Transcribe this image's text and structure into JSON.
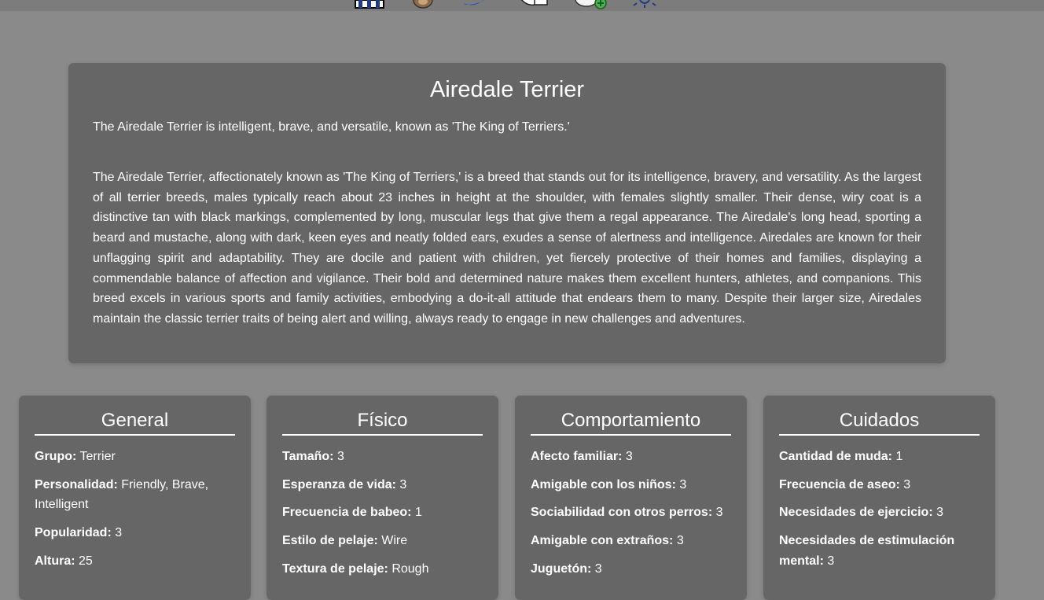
{
  "nav": {
    "icons": [
      "stats-icon",
      "dog-face-icon",
      "swoosh-icon",
      "hand-pet-icon",
      "add-dog-icon",
      "sun-icon"
    ]
  },
  "breed": {
    "name": "Airedale Terrier",
    "short_description": "The Airedale Terrier is intelligent, brave, and versatile, known as 'The King of Terriers.'",
    "long_description": "The Airedale Terrier, affectionately known as 'The King of Terriers,' is a breed that stands out for its intelligence, bravery, and versatility. As the largest of all terrier breeds, males typically reach about 23 inches in height at the shoulder, with females slightly smaller. Their dense, wiry coat is a distinctive tan with black markings, complemented by long, muscular legs that give them a regal appearance. The Airedale's long head, sporting a beard and mustache, along with dark, keen eyes and neatly folded ears, exudes a sense of alertness and intelligence. Airedales are known for their unflagging spirit and adaptability. They are docile and patient with children, yet fiercely protective of their homes and families, displaying a commendable balance of affection and vigilance. Their bold and determined nature makes them excellent hunters, athletes, and companions. This breed excels in various sports and family activities, embodying a do-it-all attitude that endears them to many. Despite their larger size, Airedales maintain the classic terrier traits of being alert and willing, always ready to engage in new challenges and adventures."
  },
  "cards": [
    {
      "title": "General",
      "items": [
        {
          "label": "Grupo:",
          "value": "Terrier"
        },
        {
          "label": "Personalidad:",
          "value": "Friendly, Brave, Intelligent"
        },
        {
          "label": "Popularidad:",
          "value": "3"
        },
        {
          "label": "Altura:",
          "value": "25"
        }
      ]
    },
    {
      "title": "Físico",
      "items": [
        {
          "label": "Tamaño:",
          "value": "3"
        },
        {
          "label": "Esperanza de vida:",
          "value": "3"
        },
        {
          "label": "Frecuencia de babeo:",
          "value": "1"
        },
        {
          "label": "Estilo de pelaje:",
          "value": "Wire"
        },
        {
          "label": "Textura de pelaje:",
          "value": "Rough"
        }
      ]
    },
    {
      "title": "Comportamiento",
      "items": [
        {
          "label": "Afecto familiar:",
          "value": "3"
        },
        {
          "label": "Amigable con los niños:",
          "value": "3"
        },
        {
          "label": "Sociabilidad con otros perros:",
          "value": "3"
        },
        {
          "label": "Amigable con extraños:",
          "value": "3"
        },
        {
          "label": "Juguetón:",
          "value": "3"
        }
      ]
    },
    {
      "title": "Cuidados",
      "items": [
        {
          "label": "Cantidad de muda:",
          "value": "1"
        },
        {
          "label": "Frecuencia de aseo:",
          "value": "3"
        },
        {
          "label": "Necesidades de ejercicio:",
          "value": "3"
        },
        {
          "label": "Necesidades de estimulación mental:",
          "value": "3"
        }
      ]
    }
  ]
}
